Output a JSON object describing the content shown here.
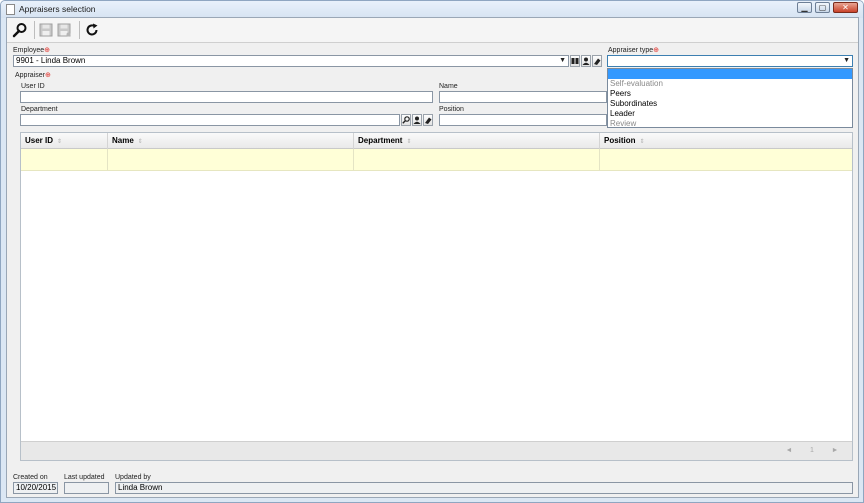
{
  "window": {
    "title": "Appraisers selection",
    "minimize_glyph": "▁",
    "maximize_glyph": "▢",
    "close_glyph": "✕"
  },
  "toolbar": {
    "icons": [
      "search-icon",
      "save-icon",
      "save-and-new-icon",
      "refresh-icon"
    ]
  },
  "form": {
    "employee": {
      "label": "Employee",
      "value": "9901 - Linda Brown"
    },
    "appraiser_type": {
      "label": "Appraiser type",
      "value": "",
      "options": [
        {
          "label": "Self-evaluation",
          "disabled": true
        },
        {
          "label": "Peers",
          "disabled": false
        },
        {
          "label": "Subordinates",
          "disabled": false
        },
        {
          "label": "Leader",
          "disabled": false
        },
        {
          "label": "Review",
          "disabled": true
        }
      ]
    },
    "appraiser": {
      "label": "Appraiser",
      "user_id": {
        "label": "User ID",
        "value": ""
      },
      "name": {
        "label": "Name",
        "value": ""
      },
      "department": {
        "label": "Department",
        "value": ""
      },
      "position": {
        "label": "Position",
        "value": ""
      }
    }
  },
  "grid": {
    "columns": [
      "User ID",
      "Name",
      "Department",
      "Position"
    ],
    "sort_glyph": "⇕",
    "rows": [
      [
        "",
        "",
        "",
        ""
      ]
    ],
    "pager": {
      "prev": "◄",
      "page": "1",
      "next": "►"
    }
  },
  "footer": {
    "created_on": {
      "label": "Created on",
      "value": "10/20/2015"
    },
    "last_updated": {
      "label": "Last updated",
      "value": ""
    },
    "updated_by": {
      "label": "Updated by",
      "value": "Linda Brown"
    }
  },
  "colors": {
    "required_marker": "#e0302a",
    "selected_option": "#3399ff",
    "row_highlight": "#ffffd7"
  }
}
